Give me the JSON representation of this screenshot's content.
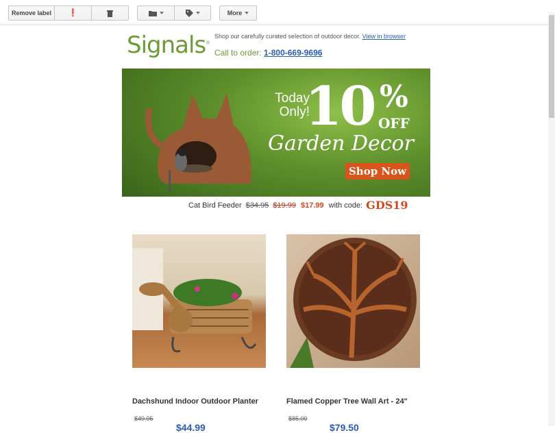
{
  "toolbar": {
    "remove_label": "Remove label",
    "report_icon": "exclamation-icon",
    "delete_icon": "trash-icon",
    "move_icon": "folder-icon",
    "labels_icon": "tag-icon",
    "more_label": "More"
  },
  "header": {
    "logo": "Signals",
    "tagline": "Shop our carefully curated selection of outdoor decor.",
    "view_in_browser": "View in browser",
    "call_label": "Call to order:",
    "phone": "1-800-669-9696"
  },
  "banner": {
    "today": "Today",
    "only": "Only!",
    "percent": "10",
    "percent_sign": "%",
    "off": "OFF",
    "headline": "Garden Decor",
    "cta": "Shop Now",
    "product": "Cat Bird Feeder",
    "price_old_1": "$34.95",
    "price_old_2": "$19.99",
    "price_new": "$17.99",
    "code_label": "with code:",
    "code": "GDS19"
  },
  "products": [
    {
      "title": "Dachshund Indoor Outdoor Planter",
      "old_price": "$49.95",
      "new_price": "$44.99"
    },
    {
      "title": "Flamed Copper Tree Wall Art - 24\"",
      "old_price": "$85.00",
      "new_price": "$79.50"
    }
  ],
  "colors": {
    "brand_green": "#6c9a36",
    "link_blue": "#2a5db0",
    "accent_orange": "#d9541a"
  }
}
